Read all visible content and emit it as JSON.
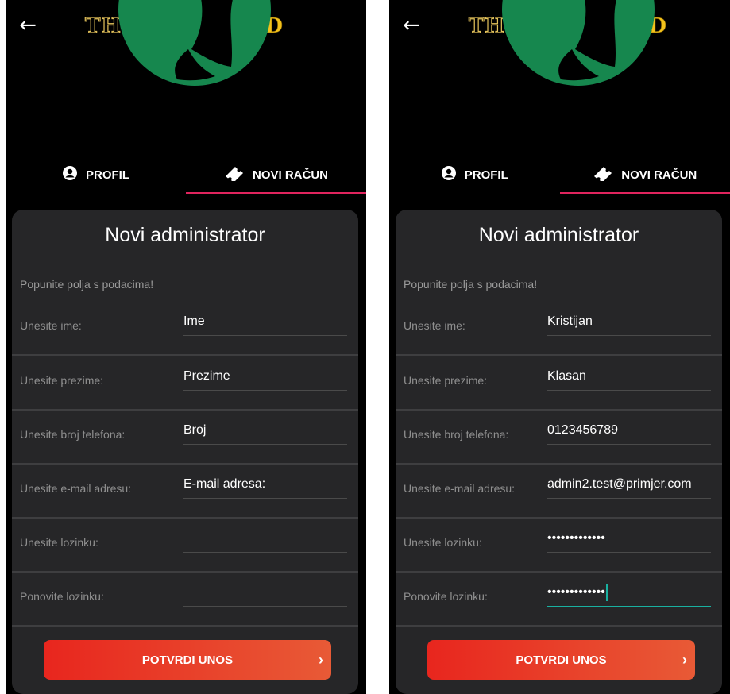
{
  "app": {
    "brand_part1": "THEATER",
    "brand_part2": "GOLD",
    "back_icon": "arrow-left-icon",
    "colors": {
      "background": "#000000",
      "card": "#262628",
      "tab_indicator": "#e0245e",
      "focus": "#19b0a0",
      "submit_start": "#e8261e",
      "submit_end": "#e85a36",
      "brand_gold": "#f3c21b"
    }
  },
  "tabs": [
    {
      "label": "PROFIL",
      "icon": "user-circle-icon",
      "active": false
    },
    {
      "label": "NOVI RAČUN",
      "icon": "ticket-icon",
      "active": true
    }
  ],
  "form": {
    "title": "Novi administrator",
    "hint": "Popunite polja s podacima!",
    "submit_label": "POTVRDI UNOS",
    "submit_icon": "chevron-right-icon"
  },
  "screens": [
    {
      "fields": [
        {
          "label": "Unesite ime:",
          "value": "Ime"
        },
        {
          "label": "Unesite prezime:",
          "value": "Prezime"
        },
        {
          "label": "Unesite broj telefona:",
          "value": "Broj"
        },
        {
          "label": "Unesite e-mail adresu:",
          "value": "E-mail adresa:"
        },
        {
          "label": "Unesite lozinku:",
          "value": ""
        },
        {
          "label": "Ponovite lozinku:",
          "value": ""
        }
      ]
    },
    {
      "fields": [
        {
          "label": "Unesite ime:",
          "value": "Kristijan"
        },
        {
          "label": "Unesite prezime:",
          "value": "Klasan"
        },
        {
          "label": "Unesite broj telefona:",
          "value": "0123456789"
        },
        {
          "label": "Unesite e-mail adresu:",
          "value": "admin2.test@primjer.com"
        },
        {
          "label": "Unesite lozinku:",
          "value": "•••••••••••••"
        },
        {
          "label": "Ponovite lozinku:",
          "value": "•••••••••••••"
        }
      ]
    }
  ]
}
